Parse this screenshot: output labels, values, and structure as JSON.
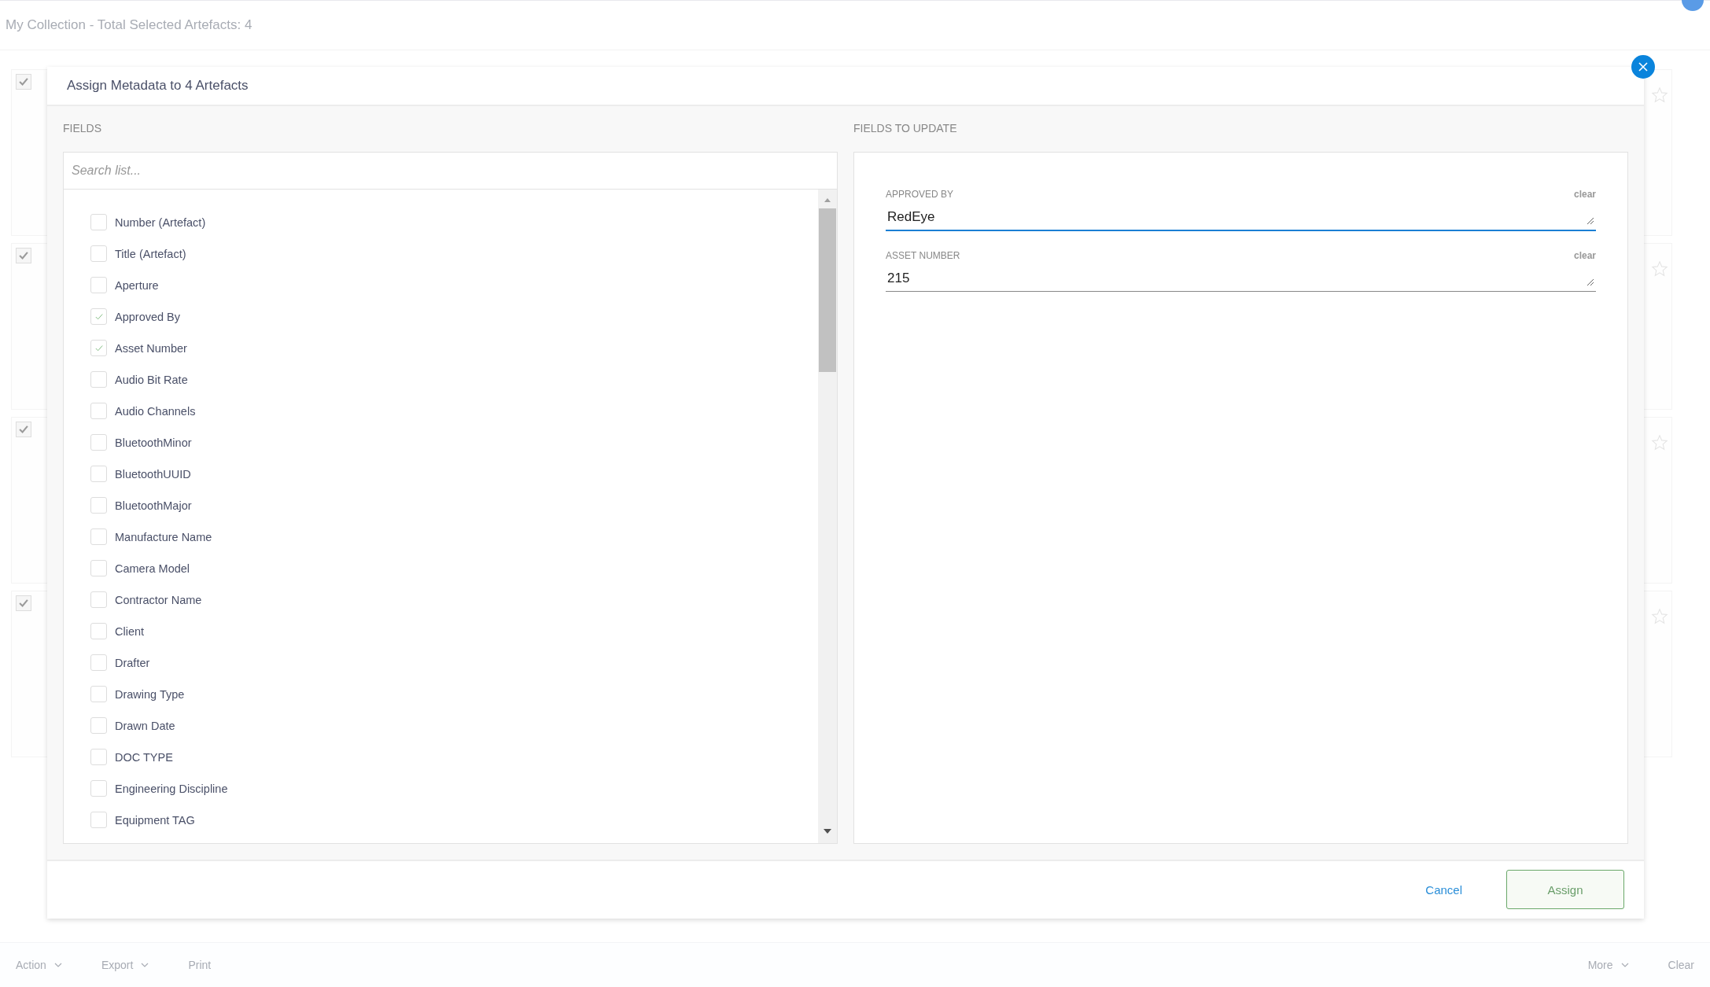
{
  "page": {
    "title": "My Collection - Total Selected Artefacts: 4"
  },
  "background_cards": [
    {
      "checked": true
    },
    {
      "checked": true
    },
    {
      "checked": true
    },
    {
      "checked": true
    }
  ],
  "dialog": {
    "title": "Assign Metadata to 4 Artefacts",
    "fields_heading": "FIELDS",
    "search": {
      "placeholder": "Search list..."
    },
    "fields": [
      {
        "label": "Number (Artefact)",
        "checked": false
      },
      {
        "label": "Title (Artefact)",
        "checked": false
      },
      {
        "label": "Aperture",
        "checked": false
      },
      {
        "label": "Approved By",
        "checked": true
      },
      {
        "label": "Asset Number",
        "checked": true
      },
      {
        "label": "Audio Bit Rate",
        "checked": false
      },
      {
        "label": "Audio Channels",
        "checked": false
      },
      {
        "label": "BluetoothMinor",
        "checked": false
      },
      {
        "label": "BluetoothUUID",
        "checked": false
      },
      {
        "label": "BluetoothMajor",
        "checked": false
      },
      {
        "label": "Manufacture Name",
        "checked": false
      },
      {
        "label": "Camera Model",
        "checked": false
      },
      {
        "label": "Contractor Name",
        "checked": false
      },
      {
        "label": "Client",
        "checked": false
      },
      {
        "label": "Drafter",
        "checked": false
      },
      {
        "label": "Drawing Type",
        "checked": false
      },
      {
        "label": "Drawn Date",
        "checked": false
      },
      {
        "label": "DOC TYPE",
        "checked": false
      },
      {
        "label": "Engineering Discipline",
        "checked": false
      },
      {
        "label": "Equipment TAG",
        "checked": false
      }
    ],
    "updates_heading": "FIELDS TO UPDATE",
    "updates": [
      {
        "label": "APPROVED BY",
        "value": "RedEye",
        "clear": "clear",
        "focused": true
      },
      {
        "label": "ASSET NUMBER",
        "value": "215",
        "clear": "clear",
        "focused": false
      }
    ],
    "cancel": "Cancel",
    "assign": "Assign"
  },
  "bottom_bar": [
    {
      "label": "Action",
      "caret": true
    },
    {
      "label": "Export",
      "caret": true
    },
    {
      "label": "Print",
      "caret": false
    },
    {
      "label": "More",
      "caret": true
    },
    {
      "label": "Clear",
      "caret": false
    }
  ]
}
